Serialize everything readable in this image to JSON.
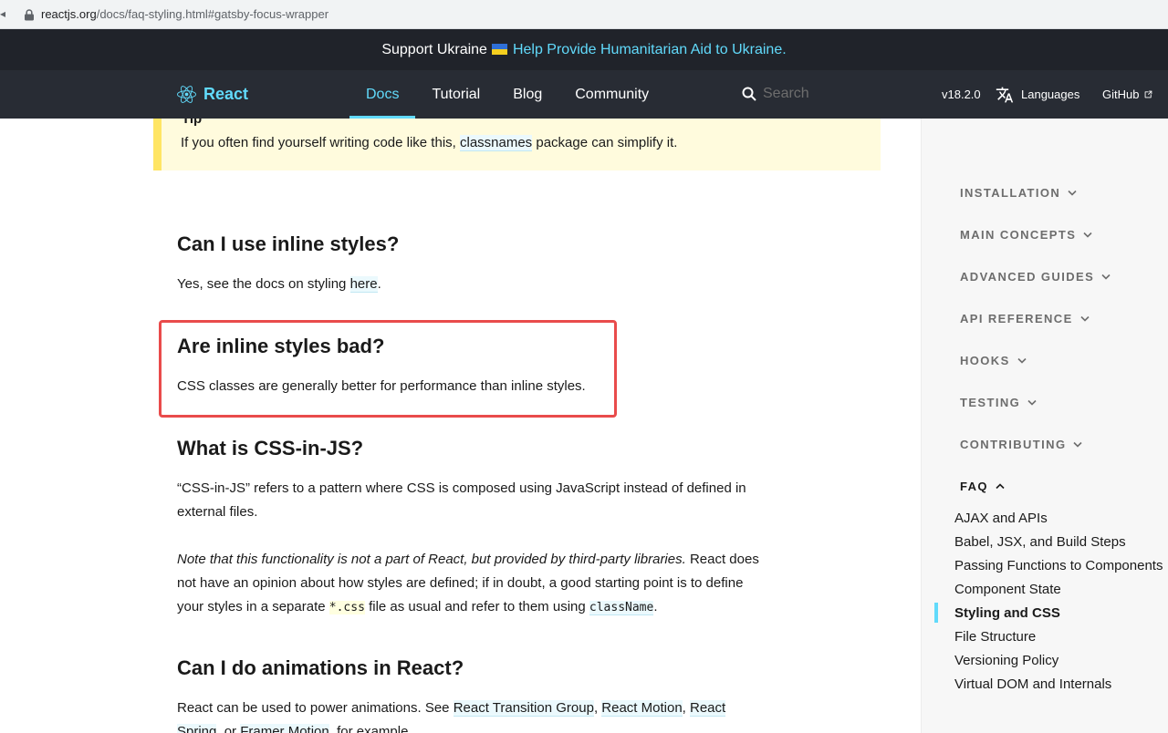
{
  "browser": {
    "url_domain": "reactjs.org",
    "url_rest": "/docs/faq-styling.html#gatsby-focus-wrapper"
  },
  "banner": {
    "text": "Support Ukraine",
    "link": "Help Provide Humanitarian Aid to Ukraine."
  },
  "nav": {
    "brand": "React",
    "links": [
      "Docs",
      "Tutorial",
      "Blog",
      "Community"
    ],
    "active": "Docs",
    "search_placeholder": "Search",
    "version": "v18.2.0",
    "languages": "Languages",
    "github": "GitHub"
  },
  "content": {
    "tip_title": "Tip",
    "tip_before": "If you often find yourself writing code like this, ",
    "tip_link": "classnames",
    "tip_after": " package can simplify it.",
    "h_inline": "Can I use inline styles?",
    "p_inline_before": "Yes, see the docs on styling ",
    "p_inline_link": "here",
    "p_inline_after": ".",
    "h_bad": "Are inline styles bad?",
    "p_bad": "CSS classes are generally better for performance than inline styles.",
    "h_cssjs": "What is CSS-in-JS?",
    "p_cssjs": "“CSS-in-JS” refers to a pattern where CSS is composed using JavaScript instead of defined in external files.",
    "p_note_italic": "Note that this functionality is not a part of React, but provided by third-party libraries.",
    "p_note_rest1": " React does not have an opinion about how styles are defined; if in doubt, a good starting point is to define your styles in a separate ",
    "p_note_code1": "*.css",
    "p_note_rest2": " file as usual and refer to them using ",
    "p_note_code2": "className",
    "p_note_end": ".",
    "h_anim": "Can I do animations in React?",
    "p_anim_before": "React can be used to power animations. See ",
    "p_anim_link1": "React Transition Group",
    "p_anim_sep1": ", ",
    "p_anim_link2": "React Motion",
    "p_anim_sep2": ", ",
    "p_anim_link3": "React Spring",
    "p_anim_sep3": ", or ",
    "p_anim_link4": "Framer Motion",
    "p_anim_after": ", for example."
  },
  "sidebar": {
    "sections": [
      "INSTALLATION",
      "MAIN CONCEPTS",
      "ADVANCED GUIDES",
      "API REFERENCE",
      "HOOKS",
      "TESTING",
      "CONTRIBUTING"
    ],
    "open_section": "FAQ",
    "faq_items": [
      "AJAX and APIs",
      "Babel, JSX, and Build Steps",
      "Passing Functions to Components",
      "Component State",
      "Styling and CSS",
      "File Structure",
      "Versioning Policy",
      "Virtual DOM and Internals"
    ],
    "active_item": "Styling and CSS"
  },
  "colors": {
    "accent": "#61dafb",
    "nav_bg": "#282c34",
    "banner_bg": "#20232a",
    "tip_bg": "#fffbdd",
    "tip_border": "#ffe564",
    "highlight_box": "#e94b4b"
  }
}
